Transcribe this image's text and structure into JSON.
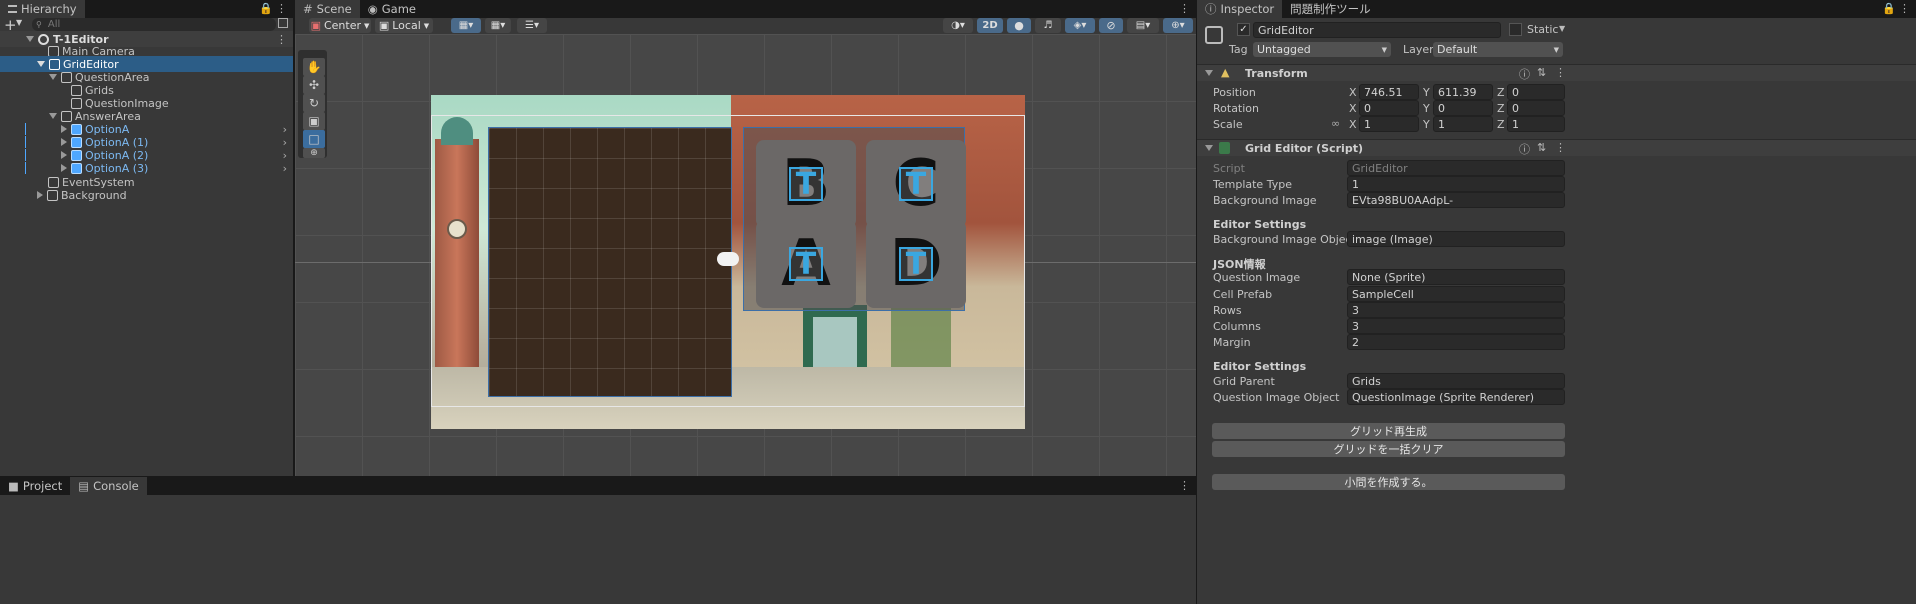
{
  "hierarchy": {
    "tab_label": "Hierarchy",
    "search_placeholder": "All",
    "scene_name": "T-1Editor",
    "items": [
      {
        "label": "Main Camera"
      },
      {
        "label": "GridEditor"
      },
      {
        "label": "QuestionArea"
      },
      {
        "label": "Grids"
      },
      {
        "label": "QuestionImage"
      },
      {
        "label": "AnswerArea"
      },
      {
        "label": "OptionA"
      },
      {
        "label": "OptionA (1)"
      },
      {
        "label": "OptionA (2)"
      },
      {
        "label": "OptionA (3)"
      },
      {
        "label": "EventSystem"
      },
      {
        "label": "Background"
      }
    ]
  },
  "scene_view": {
    "tabs": [
      "Scene",
      "Game"
    ],
    "pivot_mode": "Center",
    "pivot_space": "Local",
    "mode_2d": "2D",
    "cells": [
      "B",
      "C",
      "A",
      "D"
    ],
    "overlay_letter": "T"
  },
  "inspector": {
    "tabs": [
      "Inspector",
      "問題制作ツール"
    ],
    "object_name": "GridEditor",
    "static_label": "Static",
    "tag_label": "Tag",
    "tag_value": "Untagged",
    "layer_label": "Layer",
    "layer_value": "Default",
    "transform": {
      "title": "Transform",
      "position_label": "Position",
      "rotation_label": "Rotation",
      "scale_label": "Scale",
      "position": {
        "x": "746.51",
        "y": "611.39",
        "z": "0"
      },
      "rotation": {
        "x": "0",
        "y": "0",
        "z": "0"
      },
      "scale": {
        "x": "1",
        "y": "1",
        "z": "1"
      },
      "axis_x": "X",
      "axis_y": "Y",
      "axis_z": "Z"
    },
    "grid_editor": {
      "title": "Grid Editor (Script)",
      "script_label": "Script",
      "script_value": "GridEditor",
      "template_type_label": "Template Type",
      "template_type_value": "1",
      "background_image_label": "Background Image",
      "background_image_value": "EVta98BU0AAdpL-",
      "editor_settings_1": "Editor Settings",
      "bg_image_object_label": "Background Image Object",
      "bg_image_object_value": "image (Image)",
      "json_header": "JSON情報",
      "question_image_label": "Question Image",
      "question_image_value": "None (Sprite)",
      "cell_prefab_label": "Cell Prefab",
      "cell_prefab_value": "SampleCell",
      "rows_label": "Rows",
      "rows_value": "3",
      "columns_label": "Columns",
      "columns_value": "3",
      "margin_label": "Margin",
      "margin_value": "2",
      "editor_settings_2": "Editor Settings",
      "grid_parent_label": "Grid Parent",
      "grid_parent_value": "Grids",
      "question_image_object_label": "Question Image Object",
      "question_image_object_value": "QuestionImage (Sprite Renderer)",
      "regen_button": "グリッド再生成",
      "clear_button": "グリッドを一括クリア",
      "create_button": "小問を作成する。"
    }
  },
  "bottom_tabs": [
    "Project",
    "Console"
  ],
  "colors": {
    "selection": "#2c5d87",
    "accent_blue": "#4ea7ff",
    "panel": "#383838"
  }
}
